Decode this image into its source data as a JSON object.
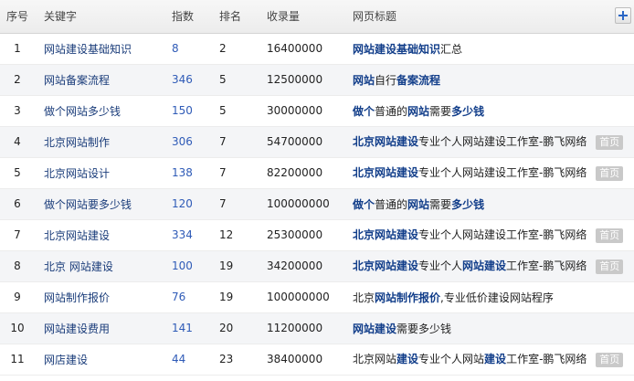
{
  "headers": {
    "no": "序号",
    "keyword": "关键字",
    "index": "指数",
    "rank": "排名",
    "volume": "收录量",
    "title": "网页标题"
  },
  "badge_label": "首页",
  "add_icon": "plus-icon",
  "rows": [
    {
      "no": "1",
      "keyword": "网站建设基础知识",
      "index": "8",
      "rank": "2",
      "volume": "16400000",
      "title": [
        {
          "t": "网站建设基础知识",
          "b": true
        },
        {
          "t": "汇总",
          "b": false
        }
      ],
      "badge": false
    },
    {
      "no": "2",
      "keyword": "网站备案流程",
      "index": "346",
      "rank": "5",
      "volume": "12500000",
      "title": [
        {
          "t": "网站",
          "b": true
        },
        {
          "t": "自行",
          "b": false
        },
        {
          "t": "备案流程",
          "b": true
        }
      ],
      "badge": false
    },
    {
      "no": "3",
      "keyword": "做个网站多少钱",
      "index": "150",
      "rank": "5",
      "volume": "30000000",
      "title": [
        {
          "t": "做个",
          "b": true
        },
        {
          "t": "普通的",
          "b": false
        },
        {
          "t": "网站",
          "b": true
        },
        {
          "t": "需要",
          "b": false
        },
        {
          "t": "多少钱",
          "b": true
        }
      ],
      "badge": false
    },
    {
      "no": "4",
      "keyword": "北京网站制作",
      "index": "306",
      "rank": "7",
      "volume": "54700000",
      "title": [
        {
          "t": "北京网站建设",
          "b": true
        },
        {
          "t": "专业个人网站建设工作室-鹏飞网络",
          "b": false
        }
      ],
      "badge": true
    },
    {
      "no": "5",
      "keyword": "北京网站设计",
      "index": "138",
      "rank": "7",
      "volume": "82200000",
      "title": [
        {
          "t": "北京网站建设",
          "b": true
        },
        {
          "t": "专业个人网站建设工作室-鹏飞网络",
          "b": false
        }
      ],
      "badge": true
    },
    {
      "no": "6",
      "keyword": "做个网站要多少钱",
      "index": "120",
      "rank": "7",
      "volume": "100000000",
      "title": [
        {
          "t": "做个",
          "b": true
        },
        {
          "t": "普通的",
          "b": false
        },
        {
          "t": "网站",
          "b": true
        },
        {
          "t": "需要",
          "b": false
        },
        {
          "t": "多少钱",
          "b": true
        }
      ],
      "badge": false
    },
    {
      "no": "7",
      "keyword": "北京网站建设",
      "index": "334",
      "rank": "12",
      "volume": "25300000",
      "title": [
        {
          "t": "北京网站建设",
          "b": true
        },
        {
          "t": "专业个人网站建设工作室-鹏飞网络",
          "b": false
        }
      ],
      "badge": true
    },
    {
      "no": "8",
      "keyword": "北京 网站建设",
      "index": "100",
      "rank": "19",
      "volume": "34200000",
      "title": [
        {
          "t": "北京网站建设",
          "b": true
        },
        {
          "t": "专业个人",
          "b": false
        },
        {
          "t": "网站建设",
          "b": true
        },
        {
          "t": "工作室-鹏飞网络",
          "b": false
        }
      ],
      "badge": true
    },
    {
      "no": "9",
      "keyword": "网站制作报价",
      "index": "76",
      "rank": "19",
      "volume": "100000000",
      "title": [
        {
          "t": "北京",
          "b": false
        },
        {
          "t": "网站制作报价",
          "b": true
        },
        {
          "t": ",专业低价建设网站程序",
          "b": false
        }
      ],
      "badge": false
    },
    {
      "no": "10",
      "keyword": "网站建设费用",
      "index": "141",
      "rank": "20",
      "volume": "11200000",
      "title": [
        {
          "t": "网站建设",
          "b": true
        },
        {
          "t": "需要多少钱",
          "b": false
        }
      ],
      "badge": false
    },
    {
      "no": "11",
      "keyword": "网店建设",
      "index": "44",
      "rank": "23",
      "volume": "38400000",
      "title": [
        {
          "t": "北京网站",
          "b": false
        },
        {
          "t": "建设",
          "b": true
        },
        {
          "t": "专业个人网站",
          "b": false
        },
        {
          "t": "建设",
          "b": true
        },
        {
          "t": "工作室-鹏飞网络",
          "b": false
        }
      ],
      "badge": true
    }
  ]
}
